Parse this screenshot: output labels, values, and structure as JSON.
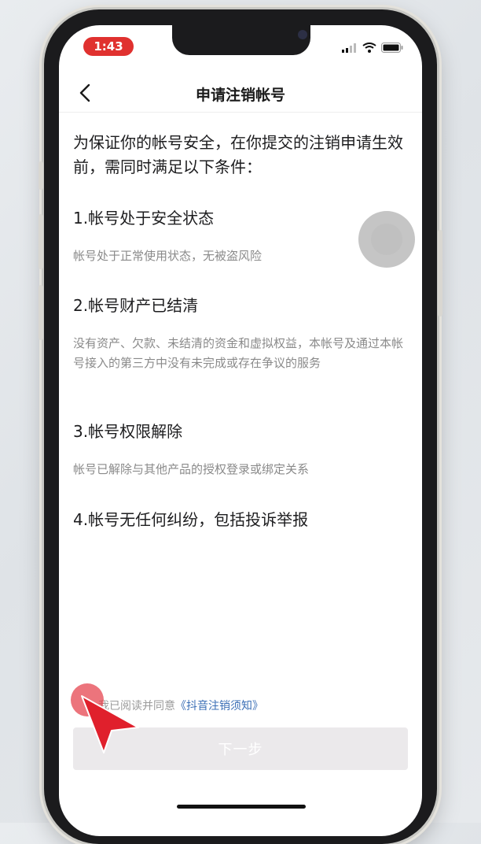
{
  "status_bar": {
    "time": "1:43"
  },
  "nav": {
    "title": "申请注销帐号"
  },
  "intro": "为保证你的帐号安全，在你提交的注销申请生效前，需同时满足以下条件：",
  "conditions": [
    {
      "title": "1.帐号处于安全状态",
      "desc": "帐号处于正常使用状态，无被盗风险"
    },
    {
      "title": "2.帐号财产已结清",
      "desc": "没有资产、欠款、未结清的资金和虚拟权益，本帐号及通过本帐号接入的第三方中没有未完成或存在争议的服务"
    },
    {
      "title": "3.帐号权限解除",
      "desc": "帐号已解除与其他产品的授权登录或绑定关系"
    },
    {
      "title": "4.帐号无任何纠纷，包括投诉举报",
      "desc": ""
    }
  ],
  "agreement": {
    "prefix": "我已阅读并同意",
    "link": "《抖音注销须知》"
  },
  "next_button": {
    "label": "下一步"
  },
  "colors": {
    "accent_red": "#e0312f",
    "link_blue": "#3b6fb6",
    "disabled_button": "#ebe9eb"
  }
}
